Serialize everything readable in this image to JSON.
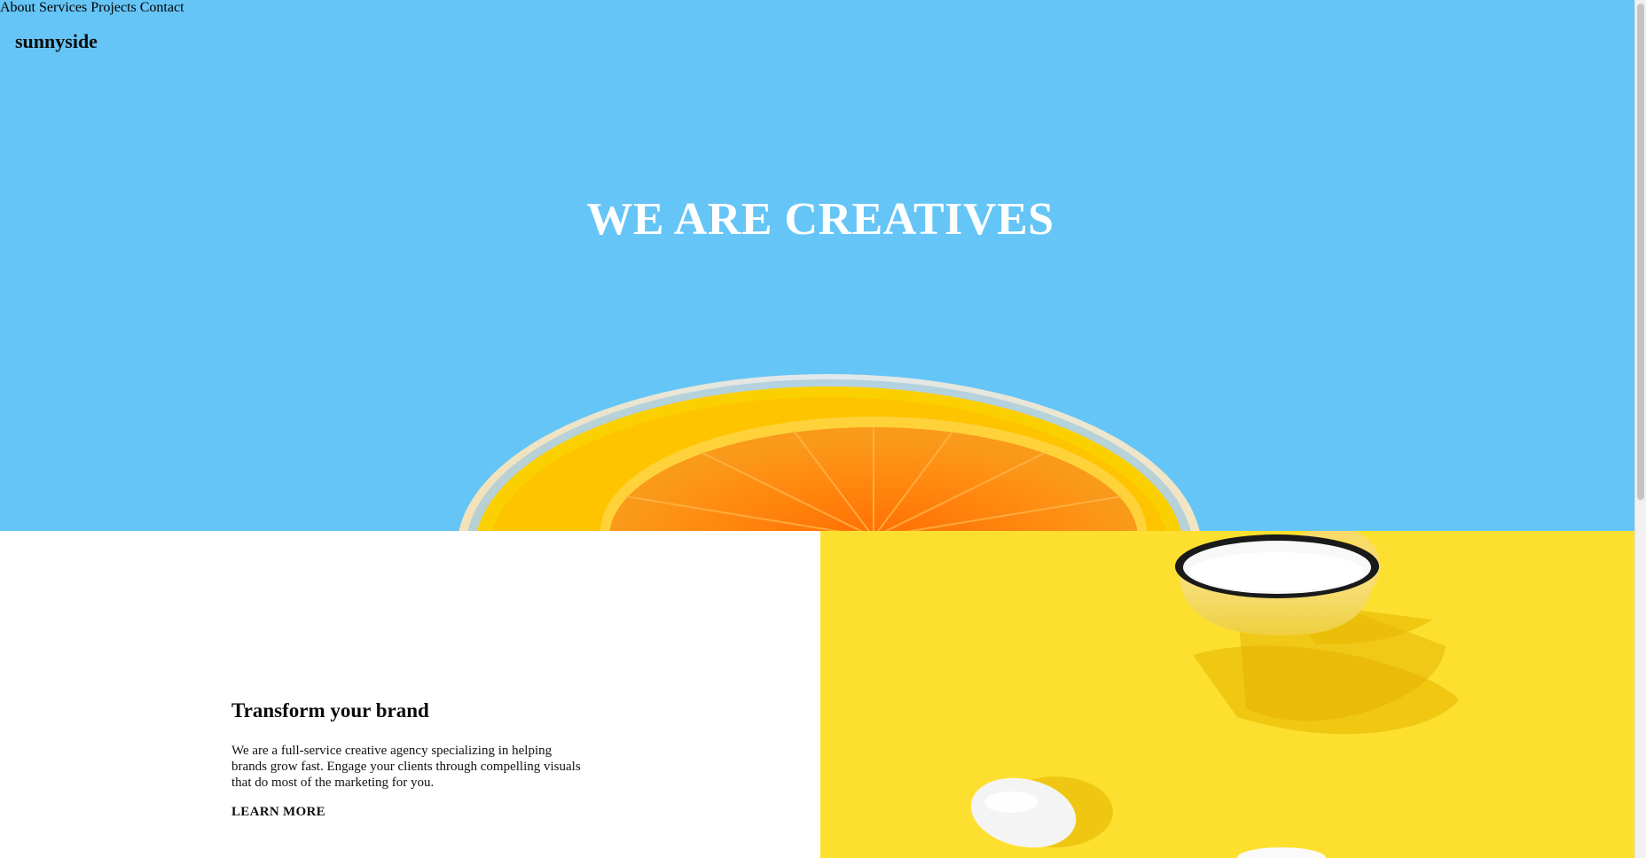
{
  "header": {
    "logo": "sunnyside",
    "nav": [
      "About",
      "Services",
      "Projects",
      "Contact"
    ]
  },
  "hero": {
    "title": "WE ARE CREATIVES",
    "image": "orange-slice-in-glass",
    "background": "#65c5f6"
  },
  "brand_section": {
    "heading": "Transform your brand",
    "body": "We are a full-service creative agency specializing in helping brands grow fast. Engage your clients through compelling visuals that do most of the marketing for you.",
    "link": "LEARN MORE",
    "image": "yellow-cup-and-egg",
    "image_background": "#fde02f"
  }
}
